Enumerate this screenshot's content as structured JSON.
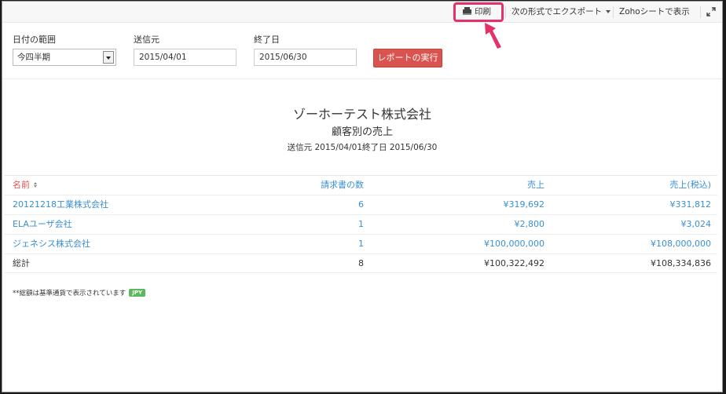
{
  "toolbar": {
    "print_label": "印刷",
    "export_label": "次の形式でエクスポート",
    "sheet_label": "Zohoシートで表示"
  },
  "filters": {
    "date_range_label": "日付の範囲",
    "date_range_value": "今四半期",
    "from_label": "送信元",
    "from_value": "2015/04/01",
    "to_label": "終了日",
    "to_value": "2015/06/30",
    "run_label": "レポートの実行"
  },
  "report": {
    "company": "ゾーホーテスト株式会社",
    "title": "顧客別の売上",
    "range": "送信元 2015/04/01終了日 2015/06/30"
  },
  "table": {
    "headers": [
      "名前",
      "請求書の数",
      "売上",
      "売上(税込)"
    ],
    "rows": [
      {
        "name": "20121218工業株式会社",
        "count": "6",
        "sales": "¥319,692",
        "sales_tax": "¥331,812"
      },
      {
        "name": "ELAユーザ会社",
        "count": "1",
        "sales": "¥2,800",
        "sales_tax": "¥3,024"
      },
      {
        "name": "ジェネシス株式会社",
        "count": "1",
        "sales": "¥100,000,000",
        "sales_tax": "¥108,000,000"
      }
    ],
    "total": {
      "name": "総計",
      "count": "8",
      "sales": "¥100,322,492",
      "sales_tax": "¥108,334,836"
    }
  },
  "note": {
    "text": "**総額は基準通貨で表示されています",
    "badge": "JPY"
  },
  "colors": {
    "accent_red": "#d9534f",
    "link_blue": "#3b8fd0",
    "highlight_pink": "#e3326a",
    "badge_green": "#5cb85c"
  }
}
